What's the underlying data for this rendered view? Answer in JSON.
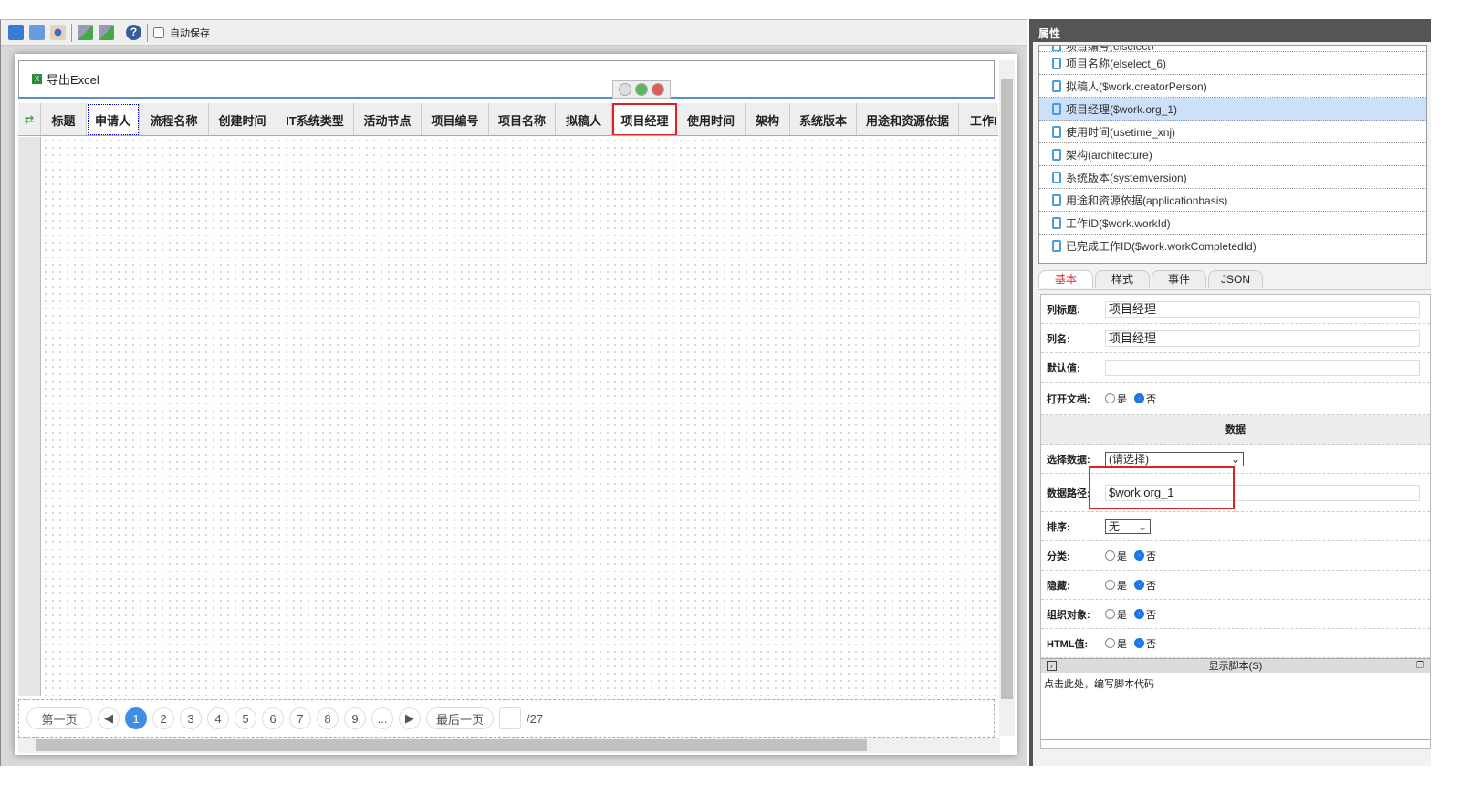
{
  "toolbar": {
    "autosave_label": "自动保存",
    "autosave_checked": false,
    "icons": [
      "save-icon",
      "save-as-icon",
      "preview-icon",
      "import-icon",
      "export-icon",
      "help-icon"
    ]
  },
  "export_button": "导出Excel",
  "columns": [
    "标题",
    "申请人",
    "流程名称",
    "创建时间",
    "IT系统类型",
    "活动节点",
    "项目编号",
    "项目名称",
    "拟稿人",
    "项目经理",
    "使用时间",
    "架构",
    "系统版本",
    "用途和资源依据",
    "工作I"
  ],
  "selected_column": "项目经理",
  "pager": {
    "first": "第一页",
    "last": "最后一页",
    "pages": [
      "1",
      "2",
      "3",
      "4",
      "5",
      "6",
      "7",
      "8",
      "9",
      "..."
    ],
    "current": "1",
    "total": "/27",
    "page_input": ""
  },
  "properties": {
    "title": "属性",
    "fields_list": [
      "项目编号(elselect)",
      "项目名称(elselect_6)",
      "拟稿人($work.creatorPerson)",
      "项目经理($work.org_1)",
      "使用时间(usetime_xnj)",
      "架构(architecture)",
      "系统版本(systemversion)",
      "用途和资源依据(applicationbasis)",
      "工作ID($work.workId)",
      "已完成工作ID($work.workCompletedId)"
    ],
    "selected_field": "项目经理($work.org_1)",
    "tabs": [
      "基本",
      "样式",
      "事件",
      "JSON"
    ],
    "active_tab": "基本",
    "col_title_label": "列标题:",
    "col_title": "项目经理",
    "col_name_label": "列名:",
    "col_name": "项目经理",
    "default_label": "默认值:",
    "default_value": "",
    "open_doc_label": "打开文档:",
    "yes": "是",
    "no": "否",
    "data_section": "数据",
    "select_data_label": "选择数据:",
    "select_data": "(请选择)",
    "data_path_label": "数据路径:",
    "data_path": "$work.org_1",
    "sort_label": "排序:",
    "sort": "无",
    "category_label": "分类:",
    "hidden_label": "隐藏:",
    "org_label": "组织对象:",
    "html_label": "HTML值:",
    "script_header": "显示脚本(S)",
    "script_placeholder": "点击此处，编写脚本代码"
  },
  "colors": {
    "accent": "#3c8ee6",
    "highlight": "#e02020",
    "header_dark": "#555555"
  }
}
